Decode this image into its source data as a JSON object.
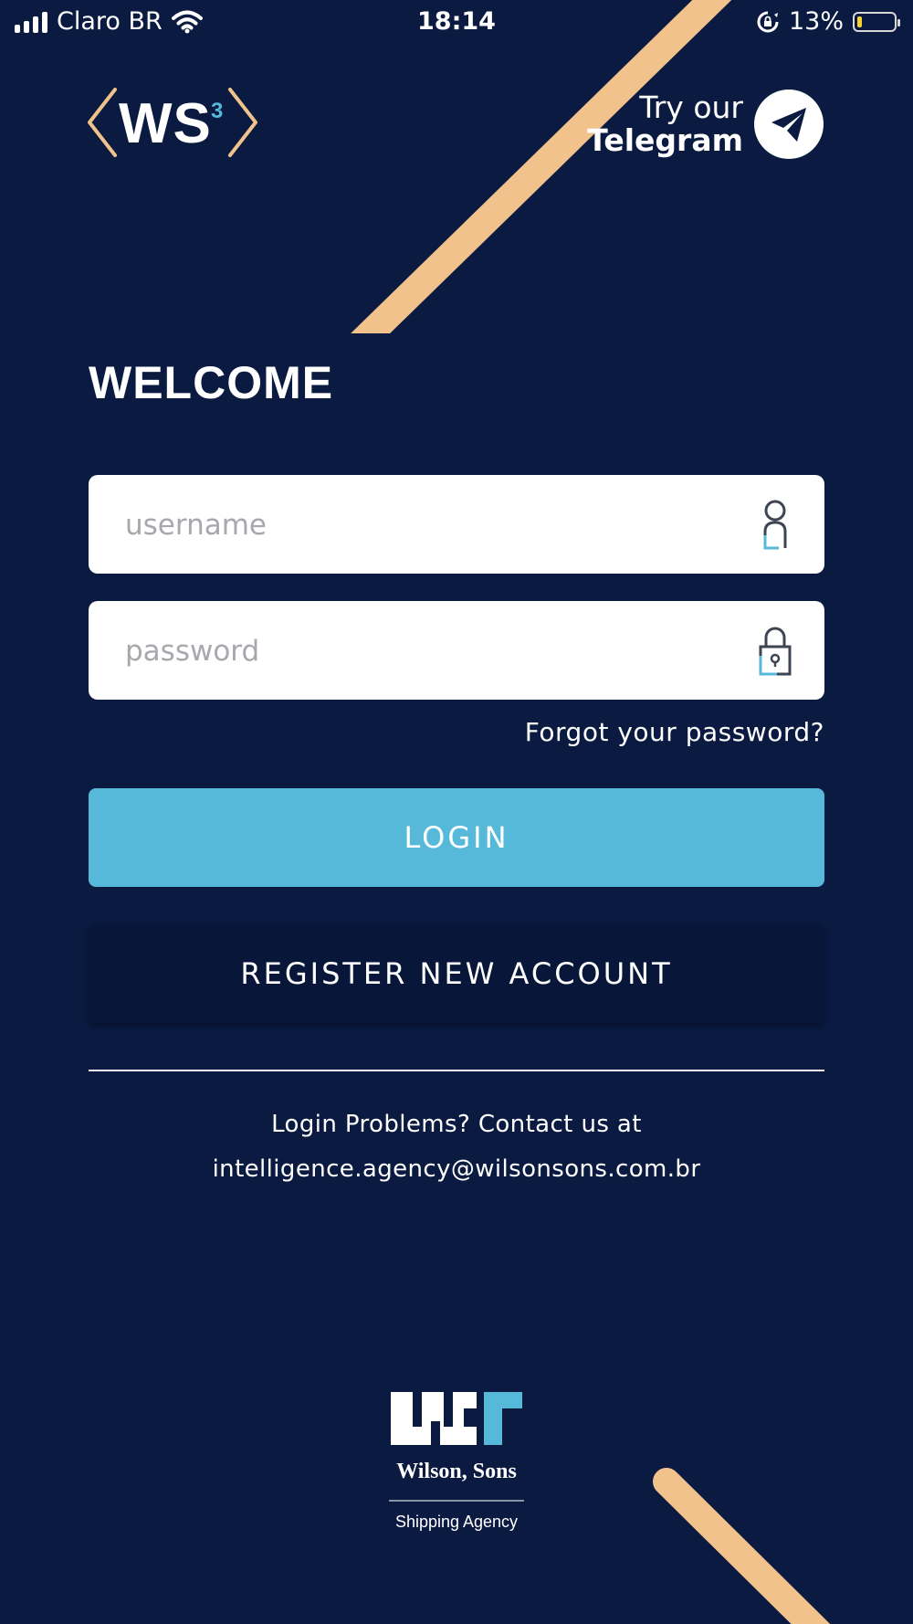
{
  "status_bar": {
    "carrier": "Claro BR",
    "time": "18:14",
    "battery": "13%",
    "battery_level": 0.13,
    "icons": [
      "signal-icon",
      "wifi-icon",
      "rotation-lock-icon",
      "battery-icon"
    ]
  },
  "brand": {
    "logo_text": "WS",
    "logo_superscript": "3",
    "accent_color": "#56b9da",
    "stripe_color": "#f2c28c",
    "background_color": "#0a1a40"
  },
  "telegram": {
    "line1": "Try our",
    "line2": "Telegram",
    "icon": "telegram-icon"
  },
  "welcome": "WELCOME",
  "form": {
    "username_placeholder": "username",
    "password_placeholder": "password",
    "username_icon": "user-icon",
    "password_icon": "lock-icon",
    "forgot_label": "Forgot your password?",
    "login_label": "LOGIN",
    "register_label": "REGISTER NEW ACCOUNT"
  },
  "contact": {
    "line1": "Login Problems? Contact us at",
    "email": "intelligence.agency@wilsonsons.com.br"
  },
  "footer": {
    "company": "Wilson, Sons",
    "subtitle": "Shipping Agency"
  }
}
